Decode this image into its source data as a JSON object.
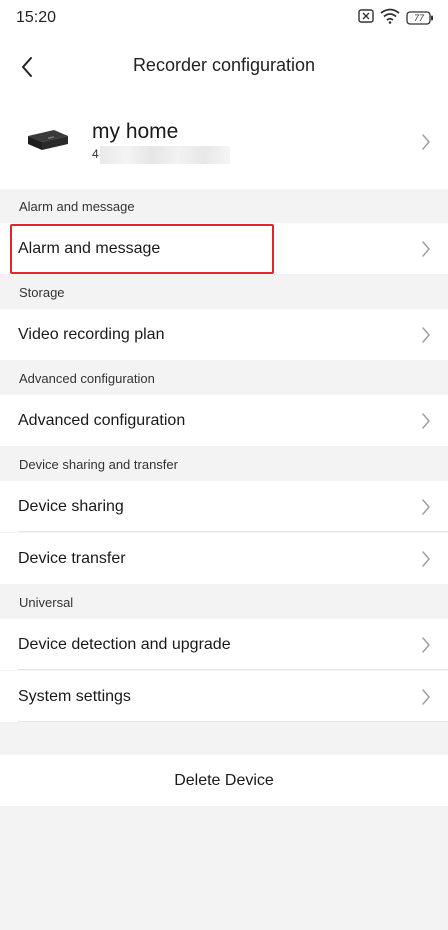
{
  "status_bar": {
    "time": "15:20",
    "battery_level": "77",
    "icons": [
      "sim-off-icon",
      "wifi-icon",
      "battery-icon"
    ]
  },
  "header": {
    "title": "Recorder configuration",
    "back_icon": "chevron-left-icon"
  },
  "device": {
    "name": "my home",
    "id_prefix": "4",
    "icon": "recorder-device-icon"
  },
  "sections": [
    {
      "header": "Alarm and message",
      "items": [
        {
          "label": "Alarm and message",
          "highlighted": true
        }
      ]
    },
    {
      "header": "Storage",
      "items": [
        {
          "label": "Video recording plan"
        }
      ]
    },
    {
      "header": "Advanced configuration",
      "items": [
        {
          "label": "Advanced configuration"
        }
      ]
    },
    {
      "header": "Device sharing and transfer",
      "items": [
        {
          "label": "Device sharing"
        },
        {
          "label": "Device transfer"
        }
      ]
    },
    {
      "header": "Universal",
      "items": [
        {
          "label": "Device detection and upgrade"
        },
        {
          "label": "System settings"
        }
      ]
    }
  ],
  "delete_label": "Delete Device",
  "colors": {
    "background": "#f3f3f3",
    "row": "#ffffff",
    "highlight_border": "#e8242b",
    "chevron": "#a0a0a0"
  }
}
